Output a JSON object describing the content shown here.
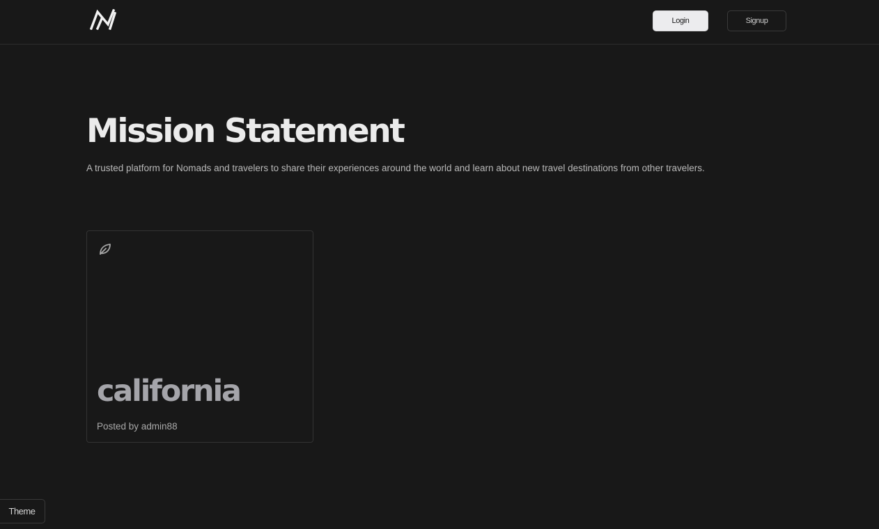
{
  "header": {
    "logo_icon": "stylized-n-logo-icon",
    "login_label": "Login",
    "signup_label": "Signup"
  },
  "hero": {
    "title": "Mission Statement",
    "subtitle": "A trusted platform for Nomads and travelers to share their experiences around the world and learn about new travel destinations from other travelers."
  },
  "posts": [
    {
      "icon": "leaf-icon",
      "title": "california",
      "meta": "Posted by admin88"
    }
  ],
  "theme_button": {
    "label": "Theme"
  },
  "colors": {
    "background": "#181818",
    "border": "#333333",
    "login_bg": "#ececee",
    "card_title": "#a5a5aa"
  }
}
